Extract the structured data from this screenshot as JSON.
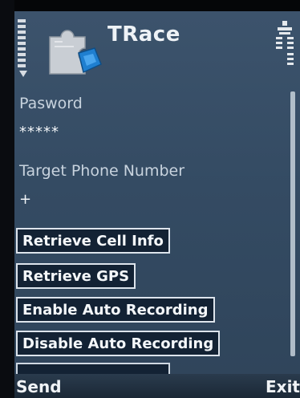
{
  "header": {
    "app_title": "TRace",
    "app_icon": "puzzle-piece-icon",
    "signal_icon": "signal-strength-icon",
    "status_icon": "network-status-icon"
  },
  "form": {
    "password_label": "Pasword",
    "password_value": "*****",
    "phone_label": "Target Phone Number",
    "phone_value": "+"
  },
  "actions": [
    {
      "label": "Retrieve Cell Info"
    },
    {
      "label": "Retrieve GPS"
    },
    {
      "label": "Enable Auto Recording"
    },
    {
      "label": "Disable Auto Recording"
    }
  ],
  "softkeys": {
    "left": "Send",
    "right": "Exit"
  },
  "colors": {
    "screen_background": "#344b63",
    "button_background": "#132234",
    "button_border": "#dde4ec",
    "text": "#f4f7fa"
  }
}
